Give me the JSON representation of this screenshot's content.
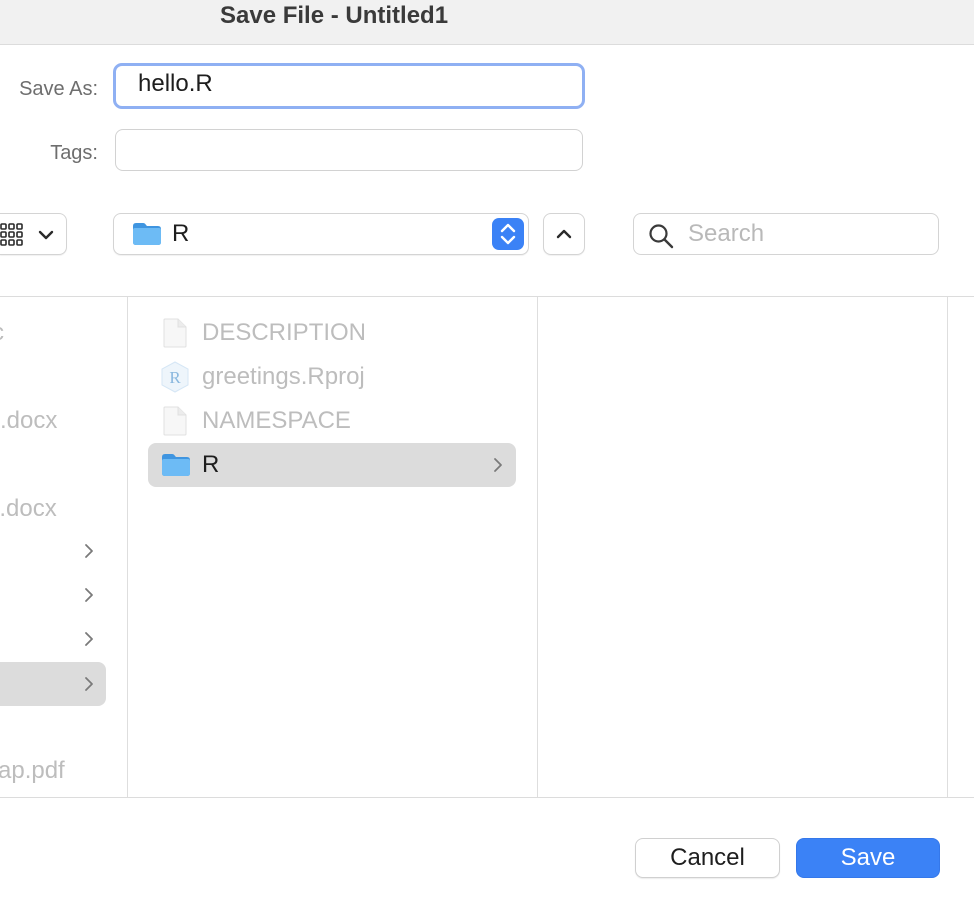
{
  "window": {
    "title": "Save File - Untitled1"
  },
  "form": {
    "save_as_label": "Save As:",
    "save_as_value": "hello.R",
    "tags_label": "Tags:",
    "tags_value": ""
  },
  "toolbar": {
    "view_mode_icon": "column-view-icon",
    "location": "R",
    "search_placeholder": "Search"
  },
  "columns": {
    "left": [
      {
        "label": "c"
      },
      {
        "label": ".docx"
      },
      {
        "label": "L.docx"
      },
      {
        "label": ""
      },
      {
        "label": ""
      },
      {
        "label": ""
      },
      {
        "label": ""
      },
      {
        "label": "ap.pdf"
      }
    ],
    "middle": [
      {
        "label": "DESCRIPTION",
        "icon": "document-icon"
      },
      {
        "label": "greetings.Rproj",
        "icon": "rproj-icon"
      },
      {
        "label": "NAMESPACE",
        "icon": "document-icon"
      },
      {
        "label": "R",
        "icon": "folder-icon",
        "selected": true
      }
    ]
  },
  "footer": {
    "cancel_label": "Cancel",
    "save_label": "Save"
  },
  "colors": {
    "accent": "#3b82f6",
    "focus_ring": "#8fb0f3",
    "selection": "#dcdcdc",
    "folder": "#5aaef0"
  }
}
